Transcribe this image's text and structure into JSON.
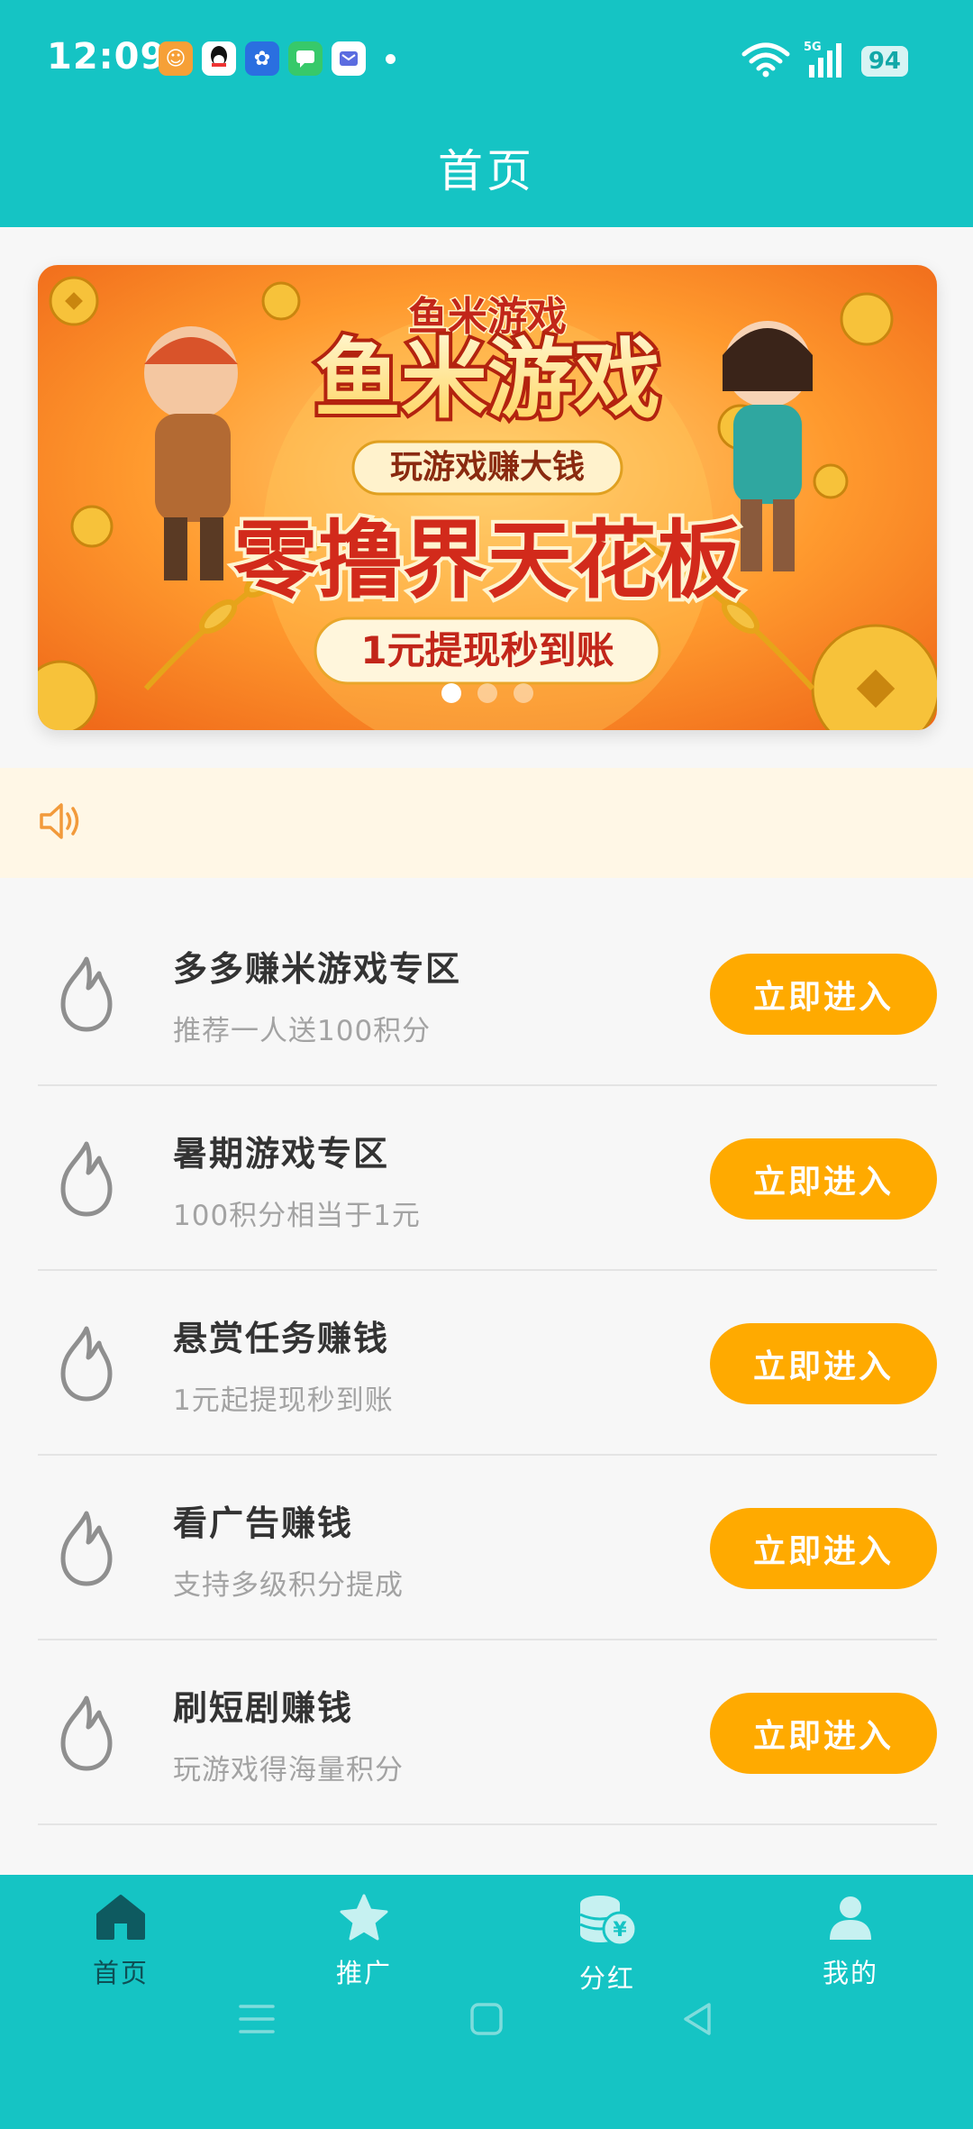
{
  "status_bar": {
    "time": "12:09",
    "battery": "94",
    "network": "5G",
    "notification_apps": [
      "app-orange-icon",
      "qq-icon",
      "pinwheel-icon",
      "messages-icon",
      "mail-icon"
    ]
  },
  "header": {
    "title": "首页"
  },
  "banner": {
    "small_title": "鱼米游戏",
    "main_title": "鱼米游戏",
    "ribbon_text": "玩游戏赚大钱",
    "headline": "零撸界天花板",
    "cta_text": "1元提现秒到账",
    "dots": 3,
    "active_dot": 0
  },
  "notice": {
    "icon": "speaker-icon"
  },
  "list": [
    {
      "title": "多多赚米游戏专区",
      "subtitle": "推荐一人送100积分",
      "button": "立即进入",
      "icon": "flame-icon"
    },
    {
      "title": "暑期游戏专区",
      "subtitle": "100积分相当于1元",
      "button": "立即进入",
      "icon": "flame-icon"
    },
    {
      "title": "悬赏任务赚钱",
      "subtitle": "1元起提现秒到账",
      "button": "立即进入",
      "icon": "flame-icon"
    },
    {
      "title": "看广告赚钱",
      "subtitle": "支持多级积分提成",
      "button": "立即进入",
      "icon": "flame-icon"
    },
    {
      "title": "刷短剧赚钱",
      "subtitle": "玩游戏得海量积分",
      "button": "立即进入",
      "icon": "flame-icon"
    }
  ],
  "tabbar": {
    "items": [
      {
        "label": "首页",
        "icon": "home-icon",
        "active": true
      },
      {
        "label": "推广",
        "icon": "star-icon",
        "active": false
      },
      {
        "label": "分红",
        "icon": "coins-icon",
        "active": false
      },
      {
        "label": "我的",
        "icon": "user-icon",
        "active": false
      }
    ]
  },
  "colors": {
    "brand": "#15c4c4",
    "button": "#ffaa00",
    "notice_bg": "#fff7e6",
    "active_tab": "#0e4f55"
  }
}
